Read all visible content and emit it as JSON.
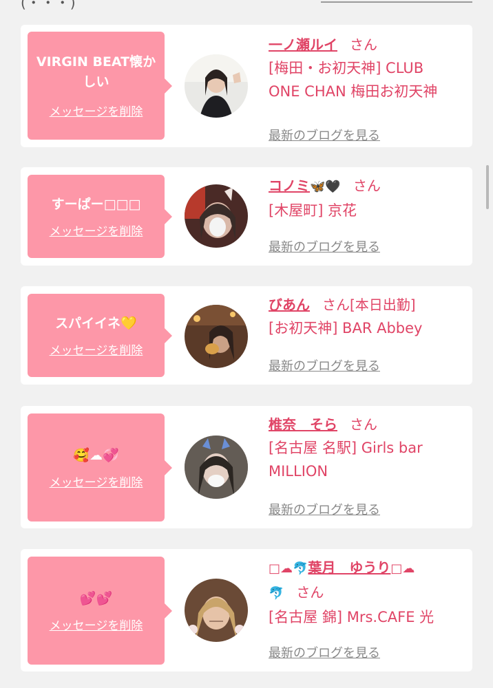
{
  "header": {
    "left_fragment": "(・・・)",
    "right_fragment": ""
  },
  "delete_label": "メッセージを削除",
  "blog_label": "最新のブログを見る",
  "san_label": "さん",
  "cards": [
    {
      "message": "VIRGIN BEAT懐かしい",
      "name": "一ノ瀬ルイ",
      "name_suffix": "",
      "shop_line1": "[梅田・お初天神] CLUB",
      "shop_line2": "ONE CHAN 梅田お初天神"
    },
    {
      "message": "すーぱー□□□",
      "name": "コノミ",
      "name_icons": "🦋🖤",
      "shop_line1": "[木屋町] 京花"
    },
    {
      "message": "スパイイネ",
      "message_icon": "💛",
      "name": "びあん",
      "status": "[本日出勤]",
      "shop_line1": "[お初天神] BAR Abbey"
    },
    {
      "message_icons": "🥰☁💞",
      "name": "椎奈　そら",
      "shop_line1": "[名古屋 名駅] Girls bar",
      "shop_line2": "MILLION"
    },
    {
      "message_icons": "💕💕",
      "name_prefix": "□☁🐬",
      "name": "葉月　ゆうり",
      "name_tail": "□☁",
      "name_line2": "🐬",
      "shop_line1": "[名古屋 錦] Mrs.CAFE 光"
    }
  ],
  "colors": {
    "accent": "#e04466",
    "bubble": "#fd97a8",
    "card_bg": "#ffffff",
    "page_bg": "#f1f1f1",
    "link_gray": "#888888"
  }
}
